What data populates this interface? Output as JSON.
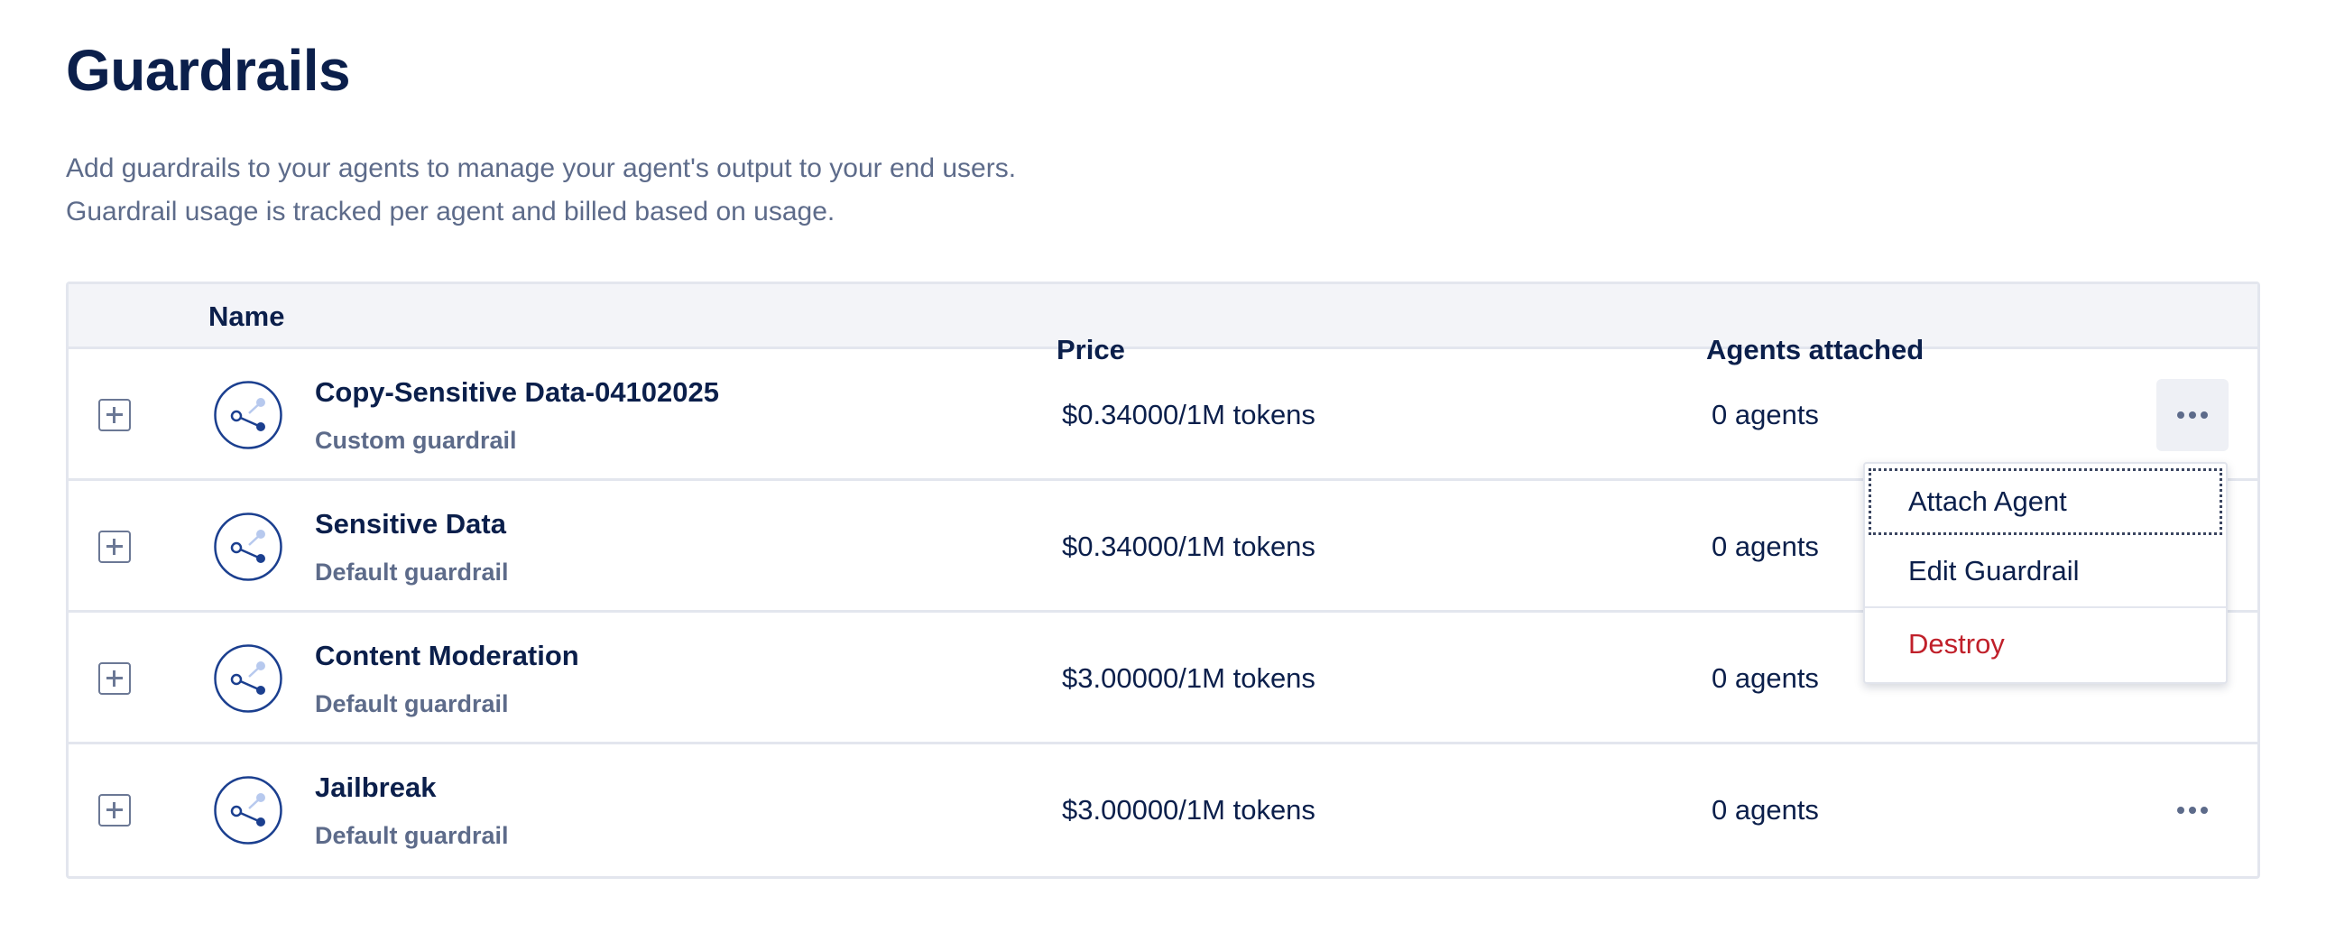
{
  "page": {
    "title": "Guardrails",
    "description_line1": "Add guardrails to your agents to manage your agent's output to your end users.",
    "description_line2": "Guardrail usage is tracked per agent and billed based on usage."
  },
  "table": {
    "headers": {
      "name": "Name",
      "price": "Price",
      "agents": "Agents attached"
    },
    "rows": [
      {
        "name": "Copy-Sensitive Data-04102025",
        "type": "Custom guardrail",
        "price": "$0.34000/1M tokens",
        "agents": "0 agents"
      },
      {
        "name": "Sensitive Data",
        "type": "Default guardrail",
        "price": "$0.34000/1M tokens",
        "agents": "0 agents"
      },
      {
        "name": "Content Moderation",
        "type": "Default guardrail",
        "price": "$3.00000/1M tokens",
        "agents": "0 agents"
      },
      {
        "name": "Jailbreak",
        "type": "Default guardrail",
        "price": "$3.00000/1M tokens",
        "agents": "0 agents"
      }
    ]
  },
  "menu": {
    "items": [
      {
        "label": "Attach Agent"
      },
      {
        "label": "Edit Guardrail"
      },
      {
        "label": "Destroy"
      }
    ]
  },
  "icons": {
    "expand": "plus-square-icon",
    "guardrail": "guardrail-node-icon",
    "more": "more-horizontal-icon"
  },
  "colors": {
    "text_primary": "#0b1f4b",
    "text_secondary": "#5d6b8a",
    "danger": "#c0202a",
    "icon_blue": "#1b3f8f",
    "header_bg": "#f3f4f8"
  }
}
